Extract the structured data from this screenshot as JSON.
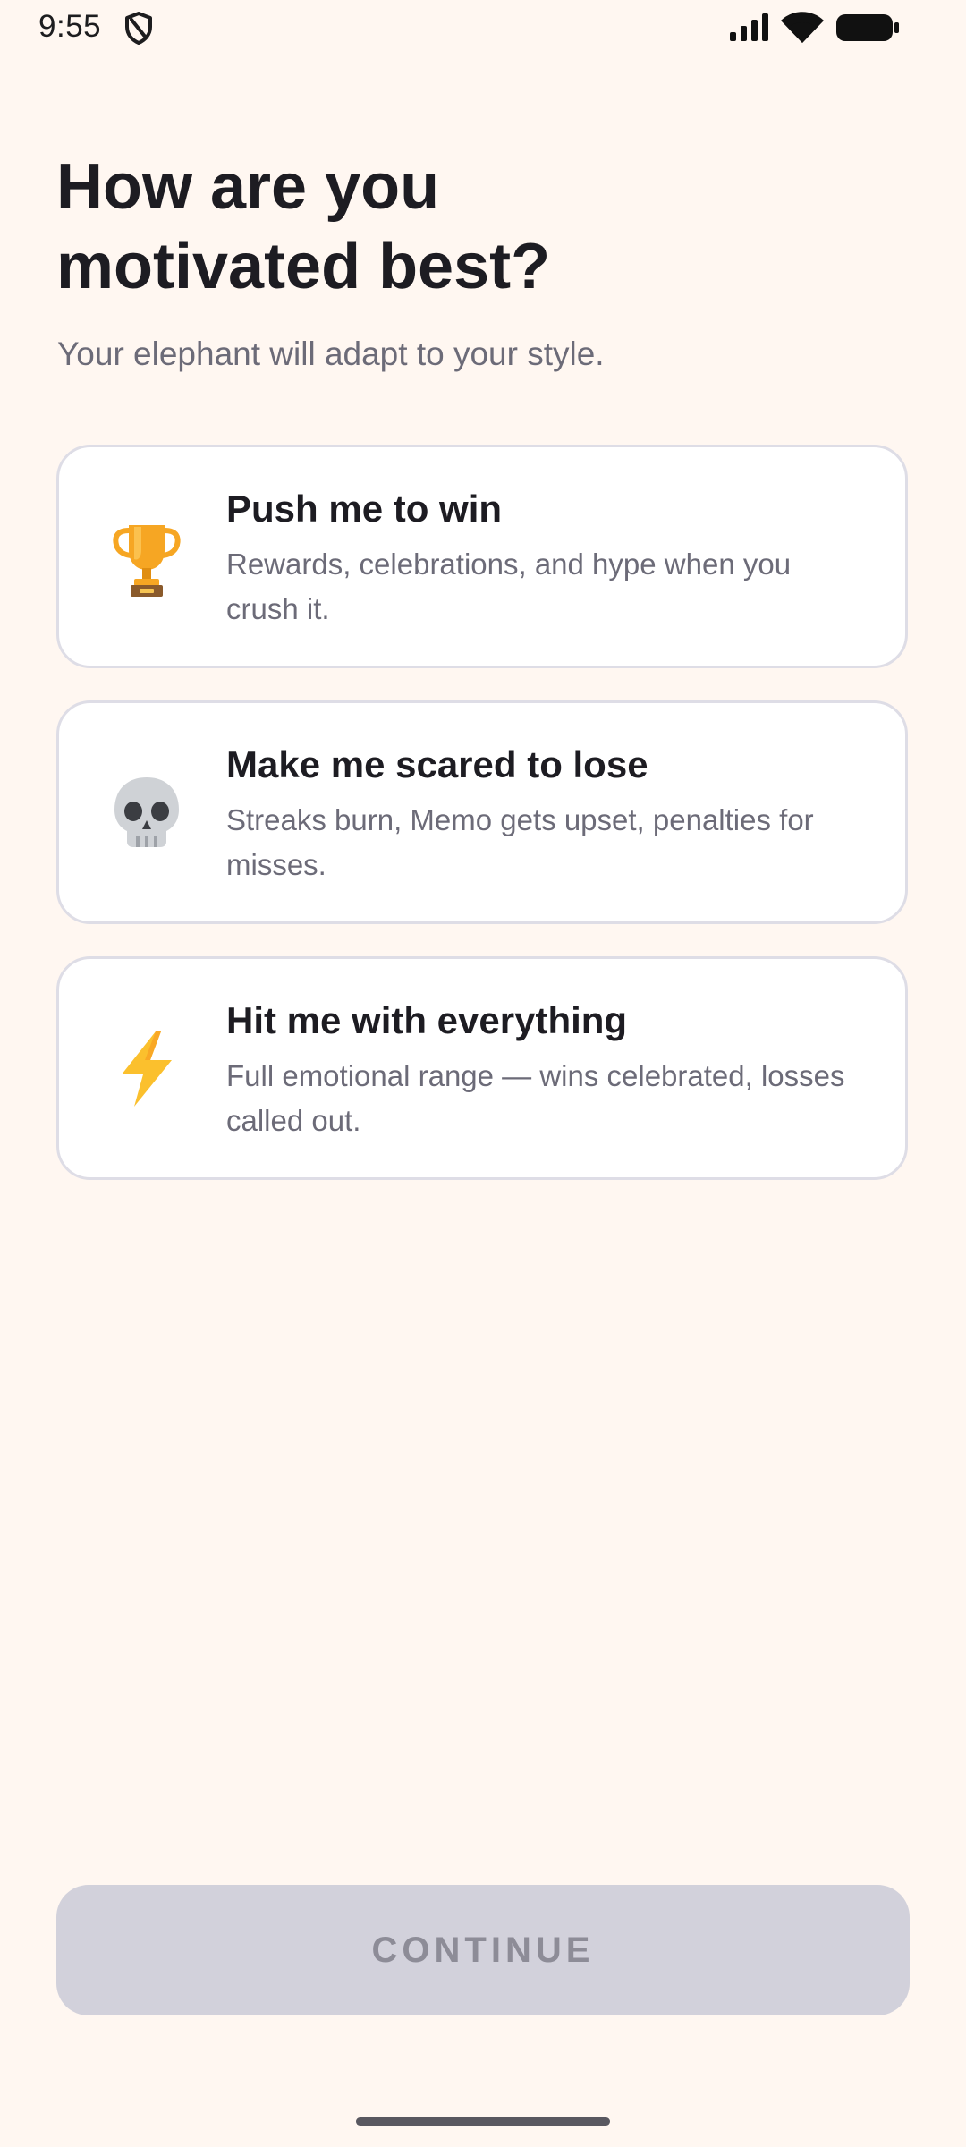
{
  "status_bar": {
    "time": "9:55",
    "icons": [
      "shield-icon",
      "signal-icon",
      "wifi-icon",
      "battery-icon"
    ]
  },
  "header": {
    "title": "How are you\nmotivated best?",
    "subtitle": "Your elephant will adapt to your style."
  },
  "options": [
    {
      "icon": "trophy-icon",
      "title": "Push me to win",
      "description": "Rewards, celebrations, and hype when you crush it."
    },
    {
      "icon": "skull-icon",
      "title": "Make me scared to lose",
      "description": "Streaks burn, Memo gets upset, penalties for misses."
    },
    {
      "icon": "lightning-icon",
      "title": "Hit me with everything",
      "description": "Full emotional range — wins celebrated, losses called out."
    }
  ],
  "footer": {
    "continue_label": "CONTINUE",
    "continue_enabled": false
  },
  "colors": {
    "background": "#fff7f1",
    "card_border": "#dedde6",
    "button_disabled_bg": "#d2d1db",
    "button_disabled_text": "#8d8c97"
  }
}
